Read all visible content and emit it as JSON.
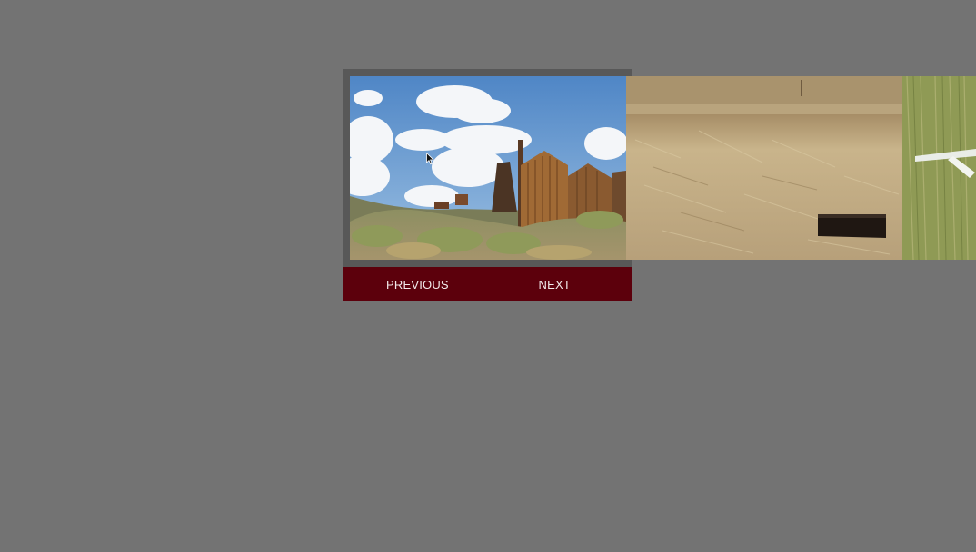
{
  "slideshow": {
    "slides": [
      {
        "name": "ghost-town-buildings-photo"
      },
      {
        "name": "dry-grassland-photo"
      },
      {
        "name": "grass-fence-photo"
      }
    ],
    "controls": {
      "previous_label": "PREVIOUS",
      "next_label": "NEXT"
    }
  },
  "colors": {
    "page_background": "#737373",
    "frame": "#585858",
    "control_bar": "#5c000c",
    "control_text": "#f2e9ea"
  }
}
